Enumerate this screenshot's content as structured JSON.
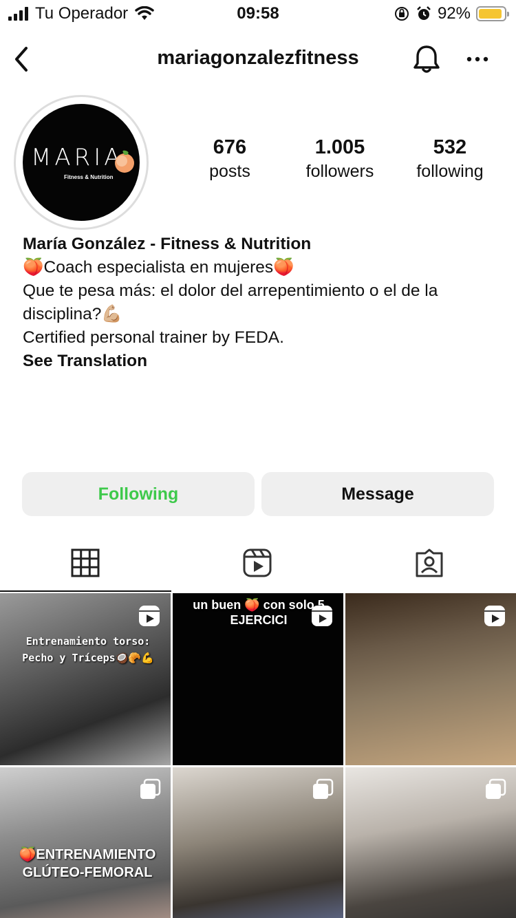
{
  "status_bar": {
    "carrier": "Tu Operador",
    "time": "09:58",
    "battery_percent": "92%",
    "battery_level": 0.92,
    "battery_color": "#f5c531"
  },
  "header": {
    "username": "mariagonzalezfitness",
    "back_icon": "chevron-left-icon",
    "bell_icon": "bell-icon",
    "more_icon": "ellipsis-icon"
  },
  "profile": {
    "avatar_logo_text": "MARIA",
    "avatar_logo_sub": "Fitness & Nutrition",
    "stats": [
      {
        "value": "676",
        "label": "posts"
      },
      {
        "value": "1.005",
        "label": "followers"
      },
      {
        "value": "532",
        "label": "following"
      }
    ],
    "display_name": "María González - Fitness & Nutrition",
    "bio_lines": [
      "🍑Coach especialista en mujeres🍑",
      "Que te pesa más: el dolor del arrepentimiento o el de la disciplina?💪🏼",
      "Certified personal trainer by FEDA."
    ],
    "see_translation": "See Translation"
  },
  "actions": {
    "following_label": "Following",
    "message_label": "Message",
    "following_color": "#3ec94b"
  },
  "tabs": [
    {
      "icon": "grid-icon",
      "active": true
    },
    {
      "icon": "reels-icon",
      "active": false
    },
    {
      "icon": "tagged-icon",
      "active": false
    }
  ],
  "posts": [
    {
      "type": "reel",
      "caption": "Entrenamiento torso: Pecho y Tríceps🥥🥐💪"
    },
    {
      "type": "reel",
      "caption": "un buen 🍑 con solo 5 EJERCICI"
    },
    {
      "type": "reel",
      "caption": ""
    },
    {
      "type": "carousel",
      "caption": "🍑ENTRENAMIENTO GLÚTEO-FEMORAL"
    },
    {
      "type": "carousel",
      "caption": ""
    },
    {
      "type": "carousel",
      "caption": ""
    }
  ]
}
